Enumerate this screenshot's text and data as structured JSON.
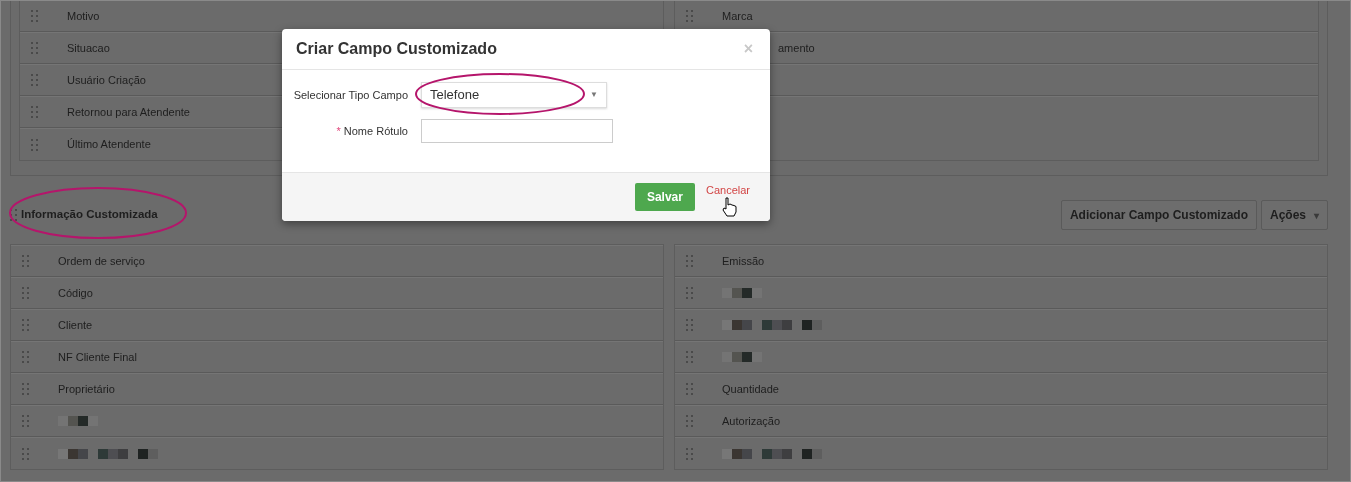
{
  "top_section": {
    "left_rows": [
      {
        "kind": "text",
        "label": "Motivo"
      },
      {
        "kind": "text",
        "label": "Situacao"
      },
      {
        "kind": "text",
        "label": "Usuário Criação"
      },
      {
        "kind": "text",
        "label": "Retornou para Atendente"
      },
      {
        "kind": "text",
        "label": "Último Atendente"
      }
    ],
    "right_rows": [
      {
        "kind": "text",
        "label": "Marca"
      },
      {
        "kind": "partial",
        "label": "amento"
      },
      {
        "kind": "empty"
      },
      {
        "kind": "empty"
      }
    ]
  },
  "custom_section": {
    "title": "Informação Customizada",
    "buttons": [
      {
        "label": "Adicionar Campo Customizado"
      },
      {
        "label": "Ações",
        "caret": "▾"
      }
    ],
    "left_rows": [
      {
        "kind": "text",
        "label": "Ordem de serviço"
      },
      {
        "kind": "text",
        "label": "Código"
      },
      {
        "kind": "text",
        "label": "Cliente"
      },
      {
        "kind": "text",
        "label": "NF Cliente Final"
      },
      {
        "kind": "text",
        "label": "Proprietário"
      },
      {
        "kind": "redacted"
      },
      {
        "kind": "redacted"
      }
    ],
    "right_rows": [
      {
        "kind": "text",
        "label": "Emissão"
      },
      {
        "kind": "redacted"
      },
      {
        "kind": "redacted"
      },
      {
        "kind": "redacted"
      },
      {
        "kind": "text",
        "label": "Quantidade"
      },
      {
        "kind": "text",
        "label": "Autorização"
      },
      {
        "kind": "redacted"
      }
    ]
  },
  "modal": {
    "title": "Criar Campo Customizado",
    "close": "×",
    "fields": [
      {
        "kind": "select",
        "label": "Selecionar Tipo Campo",
        "value": "Telefone",
        "caret": "▼"
      },
      {
        "kind": "text",
        "label": "Nome Rótulo",
        "required_mark": "*"
      }
    ],
    "buttons": [
      {
        "kind": "primary",
        "label": "Salvar"
      },
      {
        "kind": "link",
        "label": "Cancelar"
      }
    ]
  }
}
